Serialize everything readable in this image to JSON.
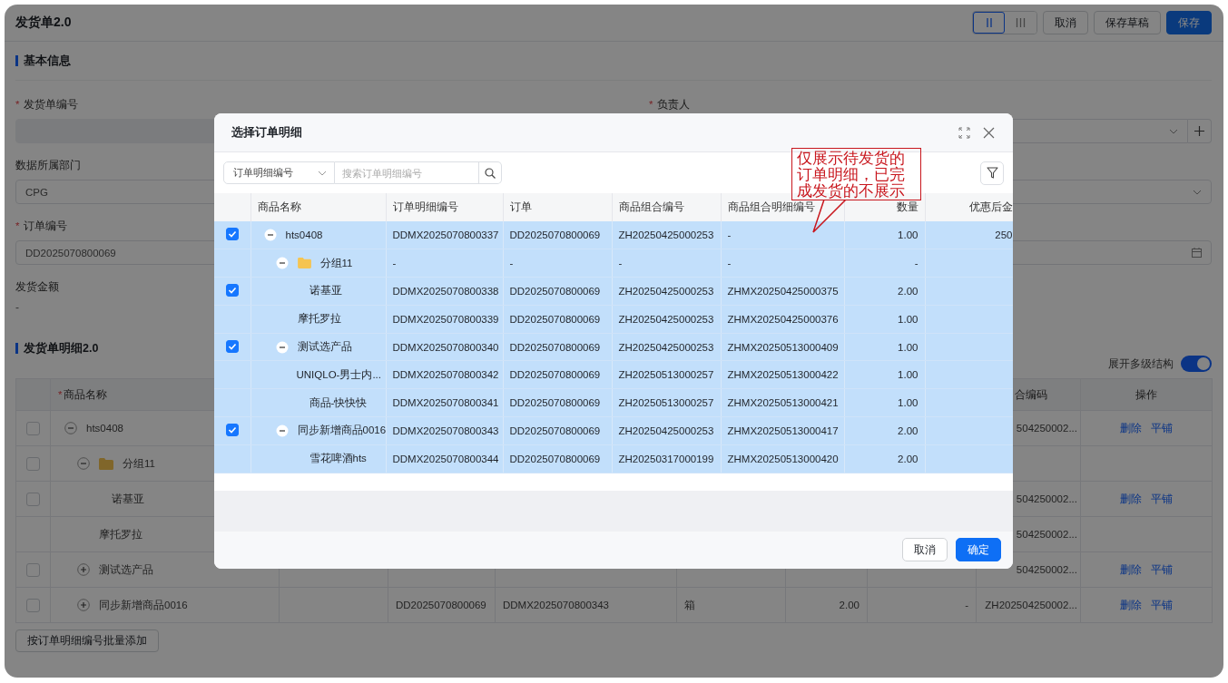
{
  "page": {
    "title": "发货单2.0",
    "view_modes": [
      {
        "kind": "two-column",
        "selected": true
      },
      {
        "kind": "three-column",
        "selected": false
      }
    ],
    "actions": [
      {
        "label": "取消",
        "kind": "default"
      },
      {
        "label": "保存草稿",
        "kind": "default"
      },
      {
        "label": "保存",
        "kind": "primary"
      }
    ]
  },
  "basic_info": {
    "title": "基本信息",
    "fields": [
      {
        "label": "发货单编号",
        "required_mark": "*",
        "kind": "disabled"
      },
      {
        "label": "负责人",
        "required_mark": "*",
        "kind": "select-add"
      },
      {
        "label": "数据所属部门",
        "kind": "select",
        "value": "CPG"
      },
      {
        "kind": "select"
      },
      {
        "label": "订单编号",
        "required_mark": "*",
        "kind": "text",
        "value": "DD2025070800069"
      },
      {
        "kind": "date"
      },
      {
        "label": "发货金额",
        "kind": "readonly",
        "value": "-"
      }
    ]
  },
  "details": {
    "title": "发货单明细2.0",
    "expand_toggle": {
      "label": "展开多级结构",
      "on": true
    },
    "table": {
      "headers": {
        "name": "商品名称",
        "name_mark": "*",
        "column_9": "合编码",
        "actions": "操作"
      },
      "rows": [
        {
          "name": "hts0408",
          "checked": false,
          "expanded": true,
          "column_9": "504250002...",
          "actions": [
            "删除",
            "平铺"
          ],
          "children": [
            {
              "name": "分组11",
              "folder": true,
              "checked": false,
              "expanded": true,
              "children": [
                {
                  "name": "诺基亚",
                  "checked": false,
                  "column_9": "504250002...",
                  "actions": [
                    "删除",
                    "平铺"
                  ]
                }
              ]
            },
            {
              "name": "摩托罗拉",
              "column_9": "504250002..."
            },
            {
              "name": "测试选产品",
              "checked": false,
              "expanded": false,
              "column_9": "504250002...",
              "actions": [
                "删除",
                "平铺"
              ]
            },
            {
              "name": "同步新增商品0016",
              "checked": false,
              "expanded": false,
              "column_4": "DD2025070800069",
              "column_5": "DDMX2025070800343",
              "column_6": "箱",
              "column_7": "2.00",
              "column_8": "-",
              "column_9": "ZH202504250002...",
              "actions": [
                "删除",
                "平铺"
              ]
            }
          ]
        }
      ]
    },
    "batch_add_button": "按订单明细编号批量添加"
  },
  "dialog": {
    "title": "选择订单明细",
    "search": {
      "field": "订单明细编号",
      "placeholder": "搜索订单明细编号"
    },
    "annotation": "仅展示待发货的订单明细，已完成发货的不展示",
    "name_column": "商品名称",
    "columns": [
      "订单明细编号",
      "订单",
      "商品组合编号",
      "商品组合明细编号",
      "数量",
      "优惠后金"
    ],
    "rows": [
      {
        "name": "hts0408",
        "checked": true,
        "expanded": true,
        "cells": [
          "DDMX2025070800337",
          "DD2025070800069",
          "ZH20250425000253",
          "-",
          "1.00",
          "250"
        ],
        "children": [
          {
            "name": "分组11",
            "folder": true,
            "expanded": true,
            "cells": [
              "-",
              "-",
              "-",
              "-",
              "-"
            ],
            "children": [
              {
                "name": "诺基亚",
                "checked": true,
                "cells": [
                  "DDMX2025070800338",
                  "DD2025070800069",
                  "ZH20250425000253",
                  "ZHMX20250425000375",
                  "2.00"
                ]
              }
            ]
          },
          {
            "name": "摩托罗拉",
            "cells": [
              "DDMX2025070800339",
              "DD2025070800069",
              "ZH20250425000253",
              "ZHMX20250425000376",
              "1.00"
            ]
          },
          {
            "name": "测试选产品",
            "checked": true,
            "expanded": true,
            "cells": [
              "DDMX2025070800340",
              "DD2025070800069",
              "ZH20250425000253",
              "ZHMX20250513000409",
              "1.00"
            ],
            "children": [
              {
                "name": "UNIQLO-男士内...",
                "cells": [
                  "DDMX2025070800342",
                  "DD2025070800069",
                  "ZH20250513000257",
                  "ZHMX20250513000422",
                  "1.00"
                ]
              },
              {
                "name": "商品-快快快",
                "cells": [
                  "DDMX2025070800341",
                  "DD2025070800069",
                  "ZH20250513000257",
                  "ZHMX20250513000421",
                  "1.00"
                ]
              }
            ]
          },
          {
            "name": "同步新增商品0016",
            "checked": true,
            "expanded": true,
            "cells": [
              "DDMX2025070800343",
              "DD2025070800069",
              "ZH20250425000253",
              "ZHMX20250513000417",
              "2.00"
            ],
            "children": [
              {
                "name": "雪花啤酒hts",
                "cells": [
                  "DDMX2025070800344",
                  "DD2025070800069",
                  "ZH20250317000199",
                  "ZHMX20250513000420",
                  "2.00"
                ]
              }
            ]
          }
        ]
      }
    ],
    "buttons": [
      {
        "label": "取消",
        "kind": "default"
      },
      {
        "label": "确定",
        "kind": "primary"
      }
    ]
  }
}
